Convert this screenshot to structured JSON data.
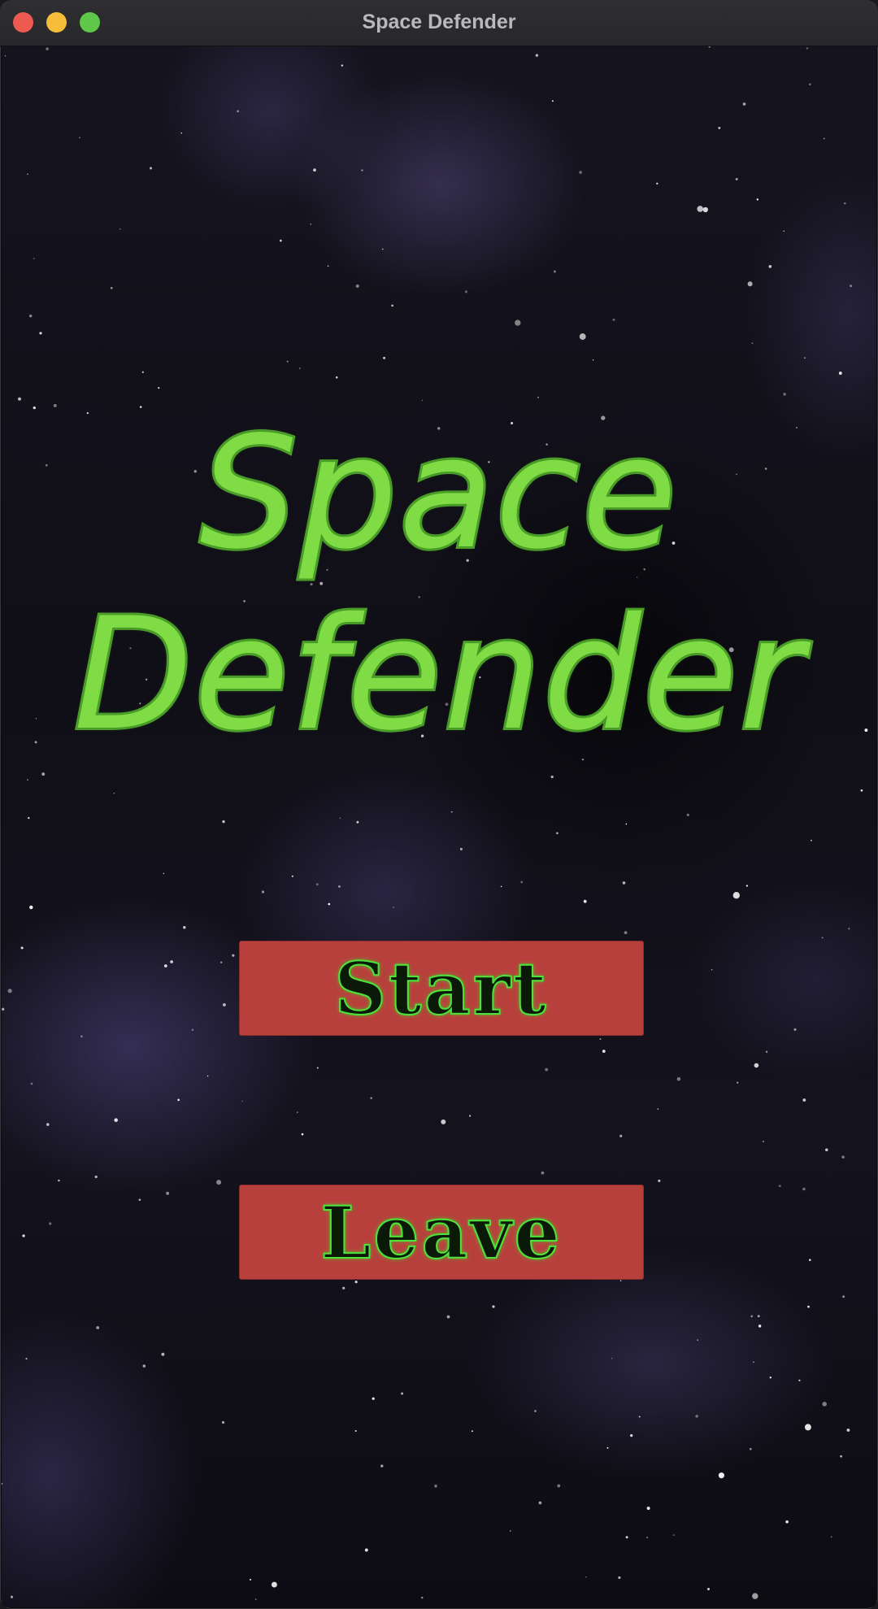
{
  "window": {
    "title": "Space Defender"
  },
  "game": {
    "title_line_1": "Space",
    "title_line_2": "Defender",
    "title_color": "#7fdc45"
  },
  "menu": {
    "start_label": "Start",
    "leave_label": "Leave",
    "button_color": "#b8403c",
    "label_glow_color": "#4fe23a"
  },
  "icons": {
    "close": "close-traffic-light",
    "minimize": "minimize-traffic-light",
    "maximize": "maximize-traffic-light"
  }
}
